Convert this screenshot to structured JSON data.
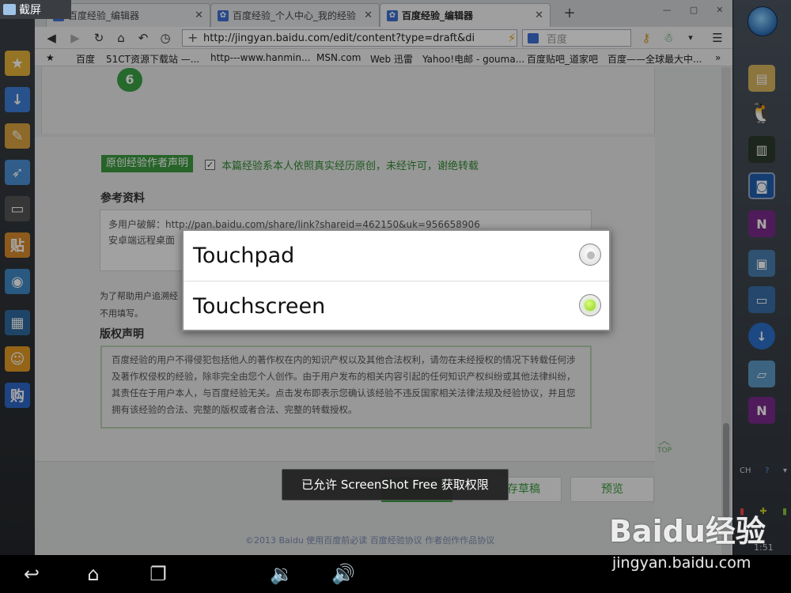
{
  "jietu_label": "截屏",
  "browser": {
    "tabs": [
      {
        "label": "百度经验_编辑器",
        "active": false
      },
      {
        "label": "百度经验_个人中心_我的经验",
        "active": false
      },
      {
        "label": "百度经验_编辑器",
        "active": true
      }
    ],
    "new_tab": "+",
    "url": "http://jingyan.baidu.com/edit/content?type=draft&di",
    "search_placeholder": "百度",
    "bookmarks": [
      "百度",
      "51CT资源下载站 —...",
      "http---www.hanmin...",
      "MSN.com",
      "Web 迅雷",
      "Yahoo!电邮 - gouma...",
      "百度贴吧_道家吧",
      "百度——全球最大中..."
    ]
  },
  "page": {
    "step_number": "6",
    "original_badge": "原创经验作者声明",
    "original_statement": "本篇经验系本人依照真实经历原创，未经许可，谢绝转载",
    "reference_title": "参考资料",
    "reference_lines": [
      "多用户破解：http://pan.baidu.com/share/link?shareid=462150&uk=956658906",
      "安卓端远程桌面"
    ],
    "help_lines": [
      "为了帮助用户追溯经",
      "不用填写。"
    ],
    "copyright_title": "版权声明",
    "copyright_text": "百度经验的用户不得侵犯包括他人的著作权在内的知识产权以及其他合法权利，请勿在未经授权的情况下转载任何涉及著作权侵权的经验，除非完全由您个人创作。由于用户发布的相关内容引起的任何知识产权纠纷或其他法律纠纷，其责任在于用户本人，与百度经验无关。点击发布即表示您确认该经验不违反国家相关法律法规及经验协议，并且您拥有该经验的合法、完整的版权或者合法、完整的转载授权。",
    "top_label": "TOP",
    "save_draft_label": "存草稿",
    "preview_label": "预览",
    "footer": "©2013 Baidu  使用百度前必读  百度经验协议  作者创作作品协议"
  },
  "dialog": {
    "options": [
      {
        "label": "Touchpad",
        "selected": false
      },
      {
        "label": "Touchscreen",
        "selected": true
      }
    ]
  },
  "toast": "已允许 ScreenShot Free 获取权限",
  "tray": {
    "lang": "CH",
    "clock": "1:51"
  },
  "watermark": {
    "logo": "Baidu经验",
    "url": "jingyan.baidu.com"
  },
  "colors": {
    "accent_green": "#3a9a3c",
    "radio_selected": "#8ecf1a"
  }
}
